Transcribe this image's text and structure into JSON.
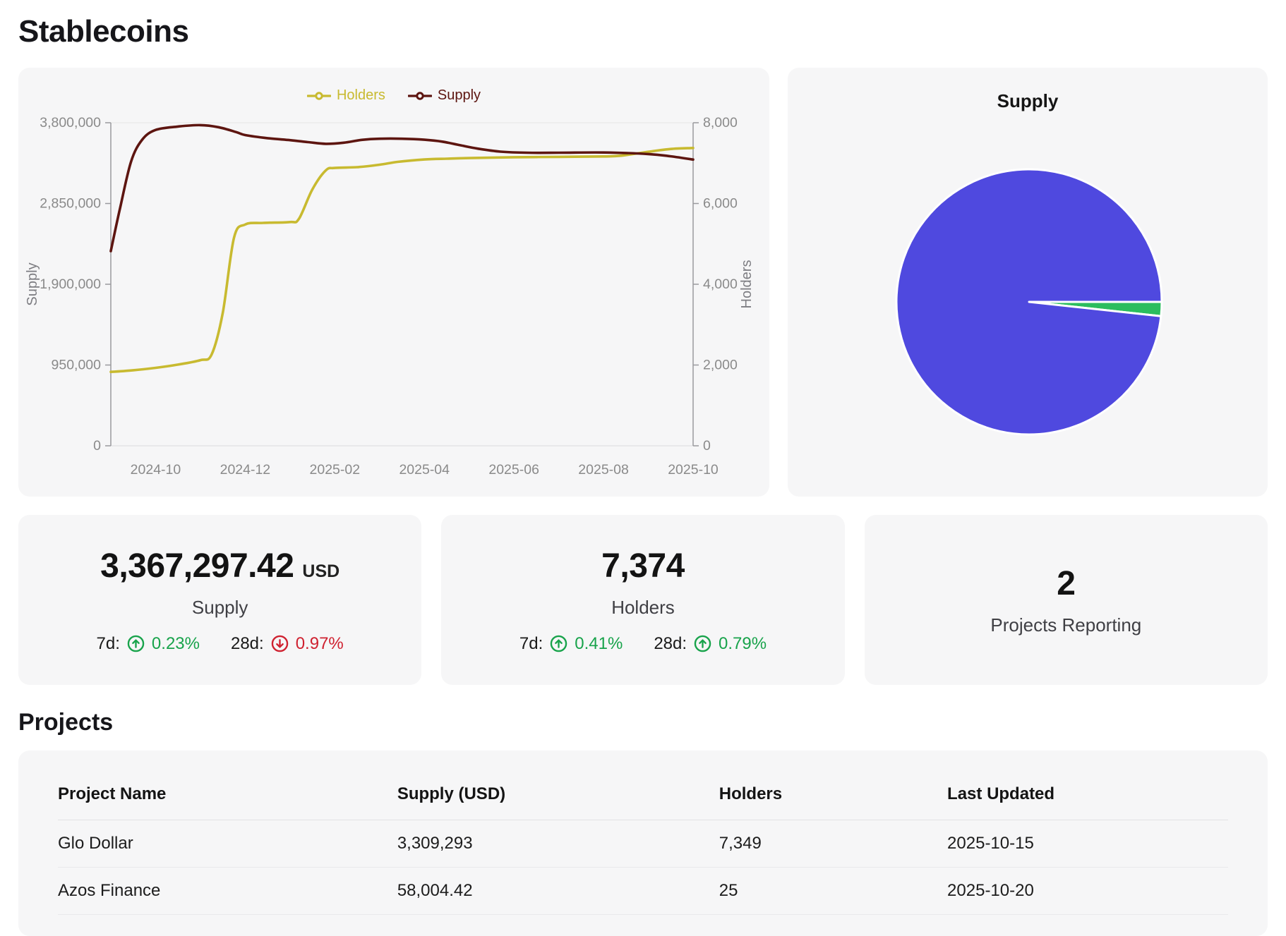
{
  "title": "Stablecoins",
  "colors": {
    "holders_line": "#c8ba30",
    "supply_line": "#5d1510",
    "pie_blue": "#4f49df",
    "pie_green": "#2bbd5e",
    "positive": "#18a34b",
    "negative": "#cf2130",
    "axis_text": "#8a8a8a",
    "card_bg": "#f6f6f7"
  },
  "chart_data": [
    {
      "type": "line",
      "title": "",
      "x_months_domain": [
        "2024-09",
        "2025-10"
      ],
      "x_tick_labels": [
        "2024-10",
        "2024-12",
        "2025-02",
        "2025-04",
        "2025-06",
        "2025-08",
        "2025-10"
      ],
      "y_left_axis": {
        "label": "Supply",
        "range": [
          0,
          3800000
        ],
        "tick_labels": [
          "0",
          "950,000",
          "1,900,000",
          "2,850,000",
          "3,800,000"
        ]
      },
      "y_right_axis": {
        "label": "Holders",
        "range": [
          0,
          8000
        ],
        "tick_labels": [
          "0",
          "2,000",
          "4,000",
          "6,000",
          "8,000"
        ]
      },
      "grid": "top-and-bottom-only",
      "legend_position": "top-center",
      "series": [
        {
          "name": "Holders",
          "axis": "right",
          "color": "#c8ba30",
          "x": [
            0,
            0.5,
            1,
            1.5,
            2,
            2.25,
            2.5,
            2.75,
            3,
            3.4,
            4,
            4.2,
            4.5,
            4.8,
            5,
            5.5,
            6,
            6.4,
            7,
            7.5,
            8,
            9,
            10,
            11,
            11.4,
            12,
            12.5,
            13
          ],
          "values": [
            1830,
            1870,
            1930,
            2010,
            2120,
            2260,
            3300,
            5150,
            5480,
            5520,
            5540,
            5620,
            6350,
            6820,
            6880,
            6900,
            6960,
            7030,
            7090,
            7110,
            7125,
            7145,
            7155,
            7165,
            7185,
            7280,
            7350,
            7374
          ]
        },
        {
          "name": "Supply",
          "axis": "left",
          "color": "#5d1510",
          "x": [
            0,
            0.2,
            0.45,
            0.7,
            1,
            1.5,
            2,
            2.4,
            2.8,
            3,
            3.5,
            4,
            4.4,
            4.8,
            5.2,
            5.6,
            6,
            6.5,
            7,
            7.4,
            7.8,
            8.2,
            8.7,
            9.3,
            10,
            11,
            12,
            12.5,
            13
          ],
          "values": [
            2290000,
            2780000,
            3340000,
            3600000,
            3715000,
            3755000,
            3772000,
            3748000,
            3690000,
            3655000,
            3618000,
            3595000,
            3572000,
            3552000,
            3565000,
            3598000,
            3612000,
            3612000,
            3600000,
            3578000,
            3535000,
            3495000,
            3460000,
            3447000,
            3447000,
            3450000,
            3432000,
            3405000,
            3367297
          ]
        }
      ]
    },
    {
      "type": "pie",
      "title": "Supply",
      "slices": [
        {
          "value": 3309293,
          "color": "#4f49df"
        },
        {
          "value": 58004.42,
          "color": "#2bbd5e"
        }
      ]
    }
  ],
  "stats": {
    "cards": [
      {
        "value": "3,367,297.42",
        "unit": "USD",
        "label": "Supply",
        "changes": [
          {
            "period": "7d:",
            "direction": "up",
            "text": "0.23%",
            "tone": "positive"
          },
          {
            "period": "28d:",
            "direction": "down",
            "text": "0.97%",
            "tone": "negative"
          }
        ]
      },
      {
        "value": "7,374",
        "unit": "",
        "label": "Holders",
        "changes": [
          {
            "period": "7d:",
            "direction": "up",
            "text": "0.41%",
            "tone": "positive"
          },
          {
            "period": "28d:",
            "direction": "up",
            "text": "0.79%",
            "tone": "positive"
          }
        ]
      },
      {
        "value": "2",
        "unit": "",
        "label": "Projects Reporting",
        "changes": []
      }
    ]
  },
  "projects": {
    "heading": "Projects",
    "columns": [
      "Project Name",
      "Supply (USD)",
      "Holders",
      "Last Updated"
    ],
    "rows": [
      [
        "Glo Dollar",
        "3,309,293",
        "7,349",
        "2025-10-15"
      ],
      [
        "Azos Finance",
        "58,004.42",
        "25",
        "2025-10-20"
      ]
    ]
  }
}
